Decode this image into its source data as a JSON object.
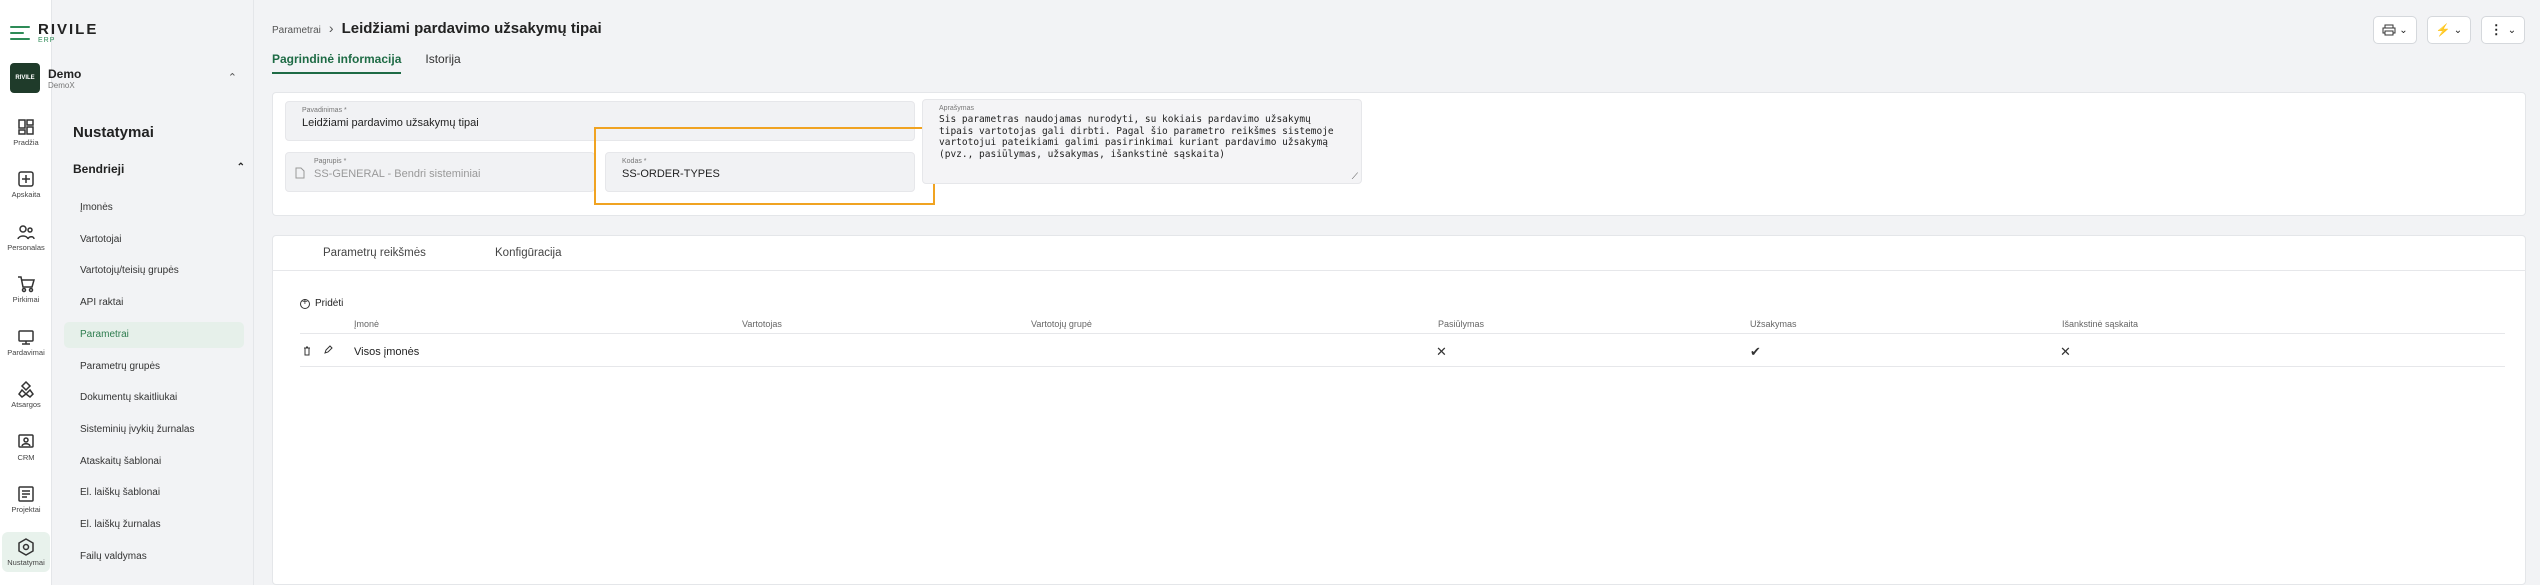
{
  "app": {
    "logo_text": "RIVILE",
    "logo_sub": "ERP"
  },
  "org": {
    "avatar_text": "RIVILE",
    "name": "Demo",
    "sub": "DemoX"
  },
  "rail": [
    {
      "label": "Pradžia",
      "icon": "dashboard-icon"
    },
    {
      "label": "Apskaita",
      "icon": "accounting-icon"
    },
    {
      "label": "Personalas",
      "icon": "people-icon"
    },
    {
      "label": "Pirkimai",
      "icon": "cart-icon"
    },
    {
      "label": "Pardavimai",
      "icon": "sales-icon"
    },
    {
      "label": "Atsargos",
      "icon": "inventory-icon"
    },
    {
      "label": "CRM",
      "icon": "crm-icon"
    },
    {
      "label": "Projektai",
      "icon": "projects-icon"
    },
    {
      "label": "Nustatymai",
      "icon": "settings-icon"
    }
  ],
  "menu": {
    "title": "Nustatymai",
    "group": "Bendrieji",
    "items": [
      "Įmonės",
      "Vartotojai",
      "Vartotojų/teisių grupės",
      "API raktai",
      "Parametrai",
      "Parametrų grupės",
      "Dokumentų skaitliukai",
      "Sisteminių įvykių žurnalas",
      "Ataskaitų šablonai",
      "El. laiškų šablonai",
      "El. laiškų žurnalas",
      "Failų valdymas"
    ],
    "active_index": 4
  },
  "header": {
    "breadcrumb": "Parametrai",
    "title": "Leidžiami pardavimo užsakymų tipai",
    "tabs": [
      "Pagrindinė informacija",
      "Istorija"
    ]
  },
  "form": {
    "name_label": "Pavadinimas *",
    "name_value": "Leidžiami pardavimo užsakymų tipai",
    "group_label": "Pagrupis *",
    "group_value": "SS-GENERAL - Bendri sisteminiai",
    "code_label": "Kodas *",
    "code_value": "SS-ORDER-TYPES",
    "desc_label": "Aprašymas",
    "desc_value": "Šis parametras naudojamas nurodyti, su kokiais pardavimo užsakymų tipais vartotojas gali dirbti. Pagal šio parametro reikšmes sistemoje vartotojui pateikiami galimi pasirinkimai kuriant pardavimo užsakymą (pvz., pasiūlymas, užsakymas, išankstinė sąskaita)"
  },
  "values_section": {
    "tabs": [
      "Parametrų reikšmės",
      "Konfigūracija"
    ],
    "add_label": "Pridėti",
    "columns": [
      "Įmonė",
      "Vartotojas",
      "Vartotojų grupė",
      "Pasiūlymas",
      "Užsakymas",
      "Išankstinė sąskaita"
    ],
    "rows": [
      {
        "company": "Visos įmonės",
        "user": "",
        "user_group": "",
        "offer": "✕",
        "order": "✔",
        "prepayment": "✕"
      }
    ]
  },
  "colors": {
    "accent": "#1e6b45",
    "highlight": "#f0a321"
  }
}
